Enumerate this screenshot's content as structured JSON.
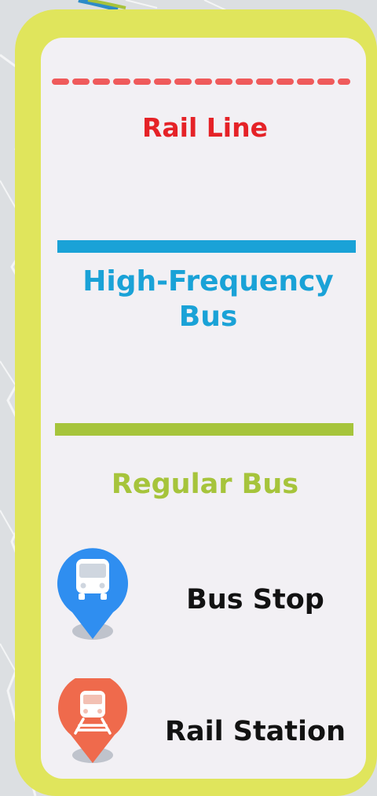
{
  "colors": {
    "frame": "#e0e55c",
    "panel": "#f2f0f4",
    "rail": "#e52227",
    "rail_line": "#ef5a5b",
    "high_frequency": "#1aa2d7",
    "regular": "#a6c43b",
    "bus_pin": "#2f8ef0",
    "rail_pin": "#ef6a4c"
  },
  "legend": {
    "rail_line": {
      "label": "Rail Line",
      "line_style": "dashed"
    },
    "high_frequency_bus": {
      "label": "High-Frequency Bus",
      "line_style": "solid"
    },
    "regular_bus": {
      "label": "Regular Bus",
      "line_style": "solid"
    },
    "bus_stop": {
      "label": "Bus Stop",
      "icon": "bus-pin-icon"
    },
    "rail_station": {
      "label": "Rail Station",
      "icon": "train-pin-icon"
    }
  }
}
